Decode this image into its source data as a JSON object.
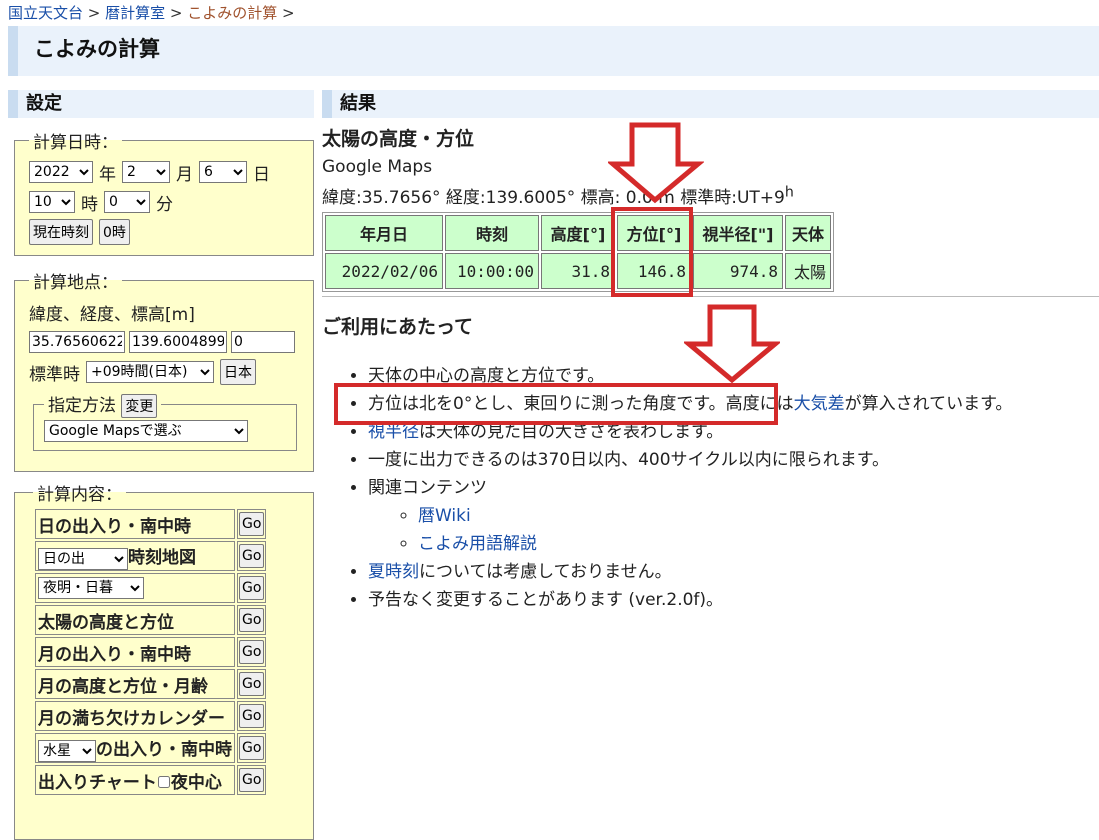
{
  "breadcrumb": {
    "item1": "国立天文台",
    "sep": " > ",
    "item2": "暦計算室",
    "item3": "こよみの計算"
  },
  "page_title": "こよみの計算",
  "settings": {
    "heading": "設定",
    "datetime": {
      "legend": "計算日時：",
      "year": "2022",
      "year_unit": "年",
      "month": "2",
      "month_unit": "月",
      "day": "6",
      "day_unit": "日",
      "hour": "10",
      "hour_unit": "時",
      "minute": "0",
      "minute_unit": "分",
      "now_button": "現在時刻",
      "zero_button": "0時"
    },
    "location": {
      "legend": "計算地点：",
      "label": "緯度、経度、標高[m]",
      "lat": "35.76560622",
      "lon": "139.6004899",
      "alt": "0",
      "tz_label": "標準時",
      "tz_value": "+09時間(日本)",
      "japan_button": "日本",
      "method_legend": "指定方法",
      "change_button": "変更",
      "method_value": "Google Mapsで選ぶ"
    },
    "content": {
      "legend": "計算内容：",
      "go": "Go",
      "items": {
        "sunrise": "日の出入り・南中時",
        "map_select": "日の出",
        "map_suffix": "時刻地図",
        "twilight_select": "夜明・日暮",
        "sun_alt": "太陽の高度と方位",
        "moonrise": "月の出入り・南中時",
        "moon_alt": "月の高度と方位・月齢",
        "moon_cal": "月の満ち欠けカレンダー",
        "planet_select": "水星",
        "planet_suffix": "の出入り・南中時",
        "chart": "出入りチャート",
        "chart_check": "夜中心"
      }
    }
  },
  "results": {
    "heading": "結果",
    "title": "太陽の高度・方位",
    "maps_link": "Google Maps",
    "coords": "緯度:35.7656° 経度:139.6005° 標高: 0.0 m 標準時:UT+9",
    "coords_sup": "h",
    "table": {
      "headers": [
        "年月日",
        "時刻",
        "高度[°]",
        "方位[°]",
        "視半径[\"]",
        "天体"
      ],
      "row": [
        "2022/02/06",
        "10:00:00",
        "31.8",
        "146.8",
        "974.8",
        "太陽"
      ]
    }
  },
  "usage": {
    "heading": "ご利用にあたって",
    "n1": "天体の中心の高度と方位です。",
    "n2a": "方位は北を0°とし、東回りに測った角度です。高度には",
    "n2link": "大気差",
    "n2b": "が算入されています。",
    "n3link": "視半径",
    "n3b": "は天体の見た目の大きさを表わします。",
    "n4": "一度に出力できるのは370日以内、400サイクル以内に限られます。",
    "n5": "関連コンテンツ",
    "sub1": "暦Wiki",
    "sub2": "こよみ用語解説",
    "n6link": "夏時刻",
    "n6b": "については考慮しておりません。",
    "n7": "予告なく変更することがあります (ver.2.0f)。"
  },
  "annotation_color": "#d42a2a"
}
